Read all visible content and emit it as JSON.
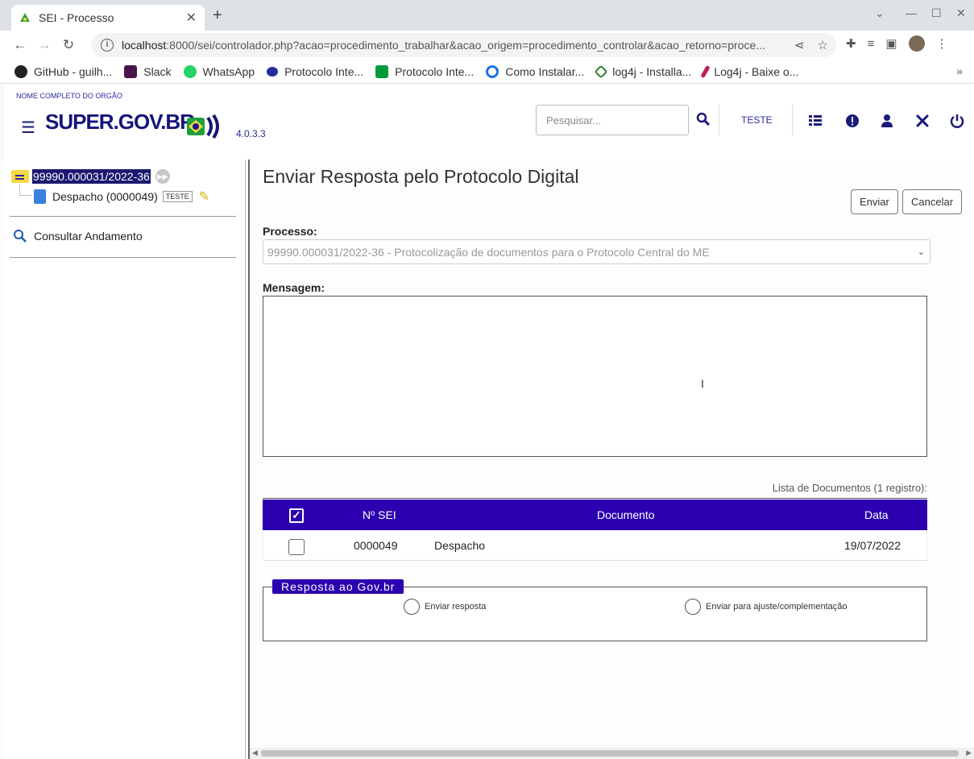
{
  "browser": {
    "tab_title": "SEI - Processo",
    "tab_close": "✕",
    "new_tab": "+",
    "url_host": "localhost",
    "url_rest": ":8000/sei/controlador.php?acao=procedimento_trabalhar&acao_origem=procedimento_controlar&acao_retorno=proce...",
    "bookmarks": [
      {
        "label": "GitHub - guilh...",
        "icon": "github-icon",
        "color": "#222222"
      },
      {
        "label": "Slack",
        "icon": "slack-icon",
        "color": "#4a154b"
      },
      {
        "label": "WhatsApp",
        "icon": "whatsapp-icon",
        "color": "#25d366"
      },
      {
        "label": "Protocolo Inte...",
        "icon": "protocolo-icon",
        "color": "#2a2aa0"
      },
      {
        "label": "Protocolo Inte...",
        "icon": "brazil-flag-icon",
        "color": "#009c3b"
      },
      {
        "label": "Como Instalar...",
        "icon": "instalar-icon",
        "color": "#1a73e8"
      },
      {
        "label": "log4j - Installa...",
        "icon": "log4j-icon",
        "color": "#2e7d32"
      },
      {
        "label": "Log4j - Baixe o...",
        "icon": "feather-icon",
        "color": "#c2185b"
      }
    ],
    "bookmarks_more": "»"
  },
  "header": {
    "org_name": "NOME COMPLETO DO ORGÃO",
    "logo_text": "SUPER.GOV.BR",
    "version": "4.0.3.3",
    "search_placeholder": "Pesquisar...",
    "unit": "TESTE"
  },
  "tree": {
    "process_number": "99990.000031/2022-36",
    "document_label": "Despacho (0000049)",
    "document_tag": "TESTE",
    "consult_label": "Consultar Andamento"
  },
  "form": {
    "title": "Enviar Resposta pelo Protocolo Digital",
    "send_button": "Enviar",
    "cancel_button": "Cancelar",
    "process_label": "Processo:",
    "process_value": "99990.000031/2022-36 - Protocolização de documentos para o Protocolo Central do ME",
    "message_label": "Mensagem:",
    "list_caption": "Lista de Documentos (1 registro):",
    "table": {
      "columns": [
        "Nº SEI",
        "Documento",
        "Data"
      ],
      "rows": [
        {
          "sei": "0000049",
          "documento": "Despacho",
          "data": "19/07/2022"
        }
      ]
    },
    "fieldset_legend": "Resposta ao Gov.br",
    "radio_options": [
      "Enviar resposta",
      "Enviar para ajuste/complementação"
    ]
  },
  "colors": {
    "primary": "#2c00b0",
    "brand_dark": "#15157a",
    "highlight": "#1c1870"
  }
}
